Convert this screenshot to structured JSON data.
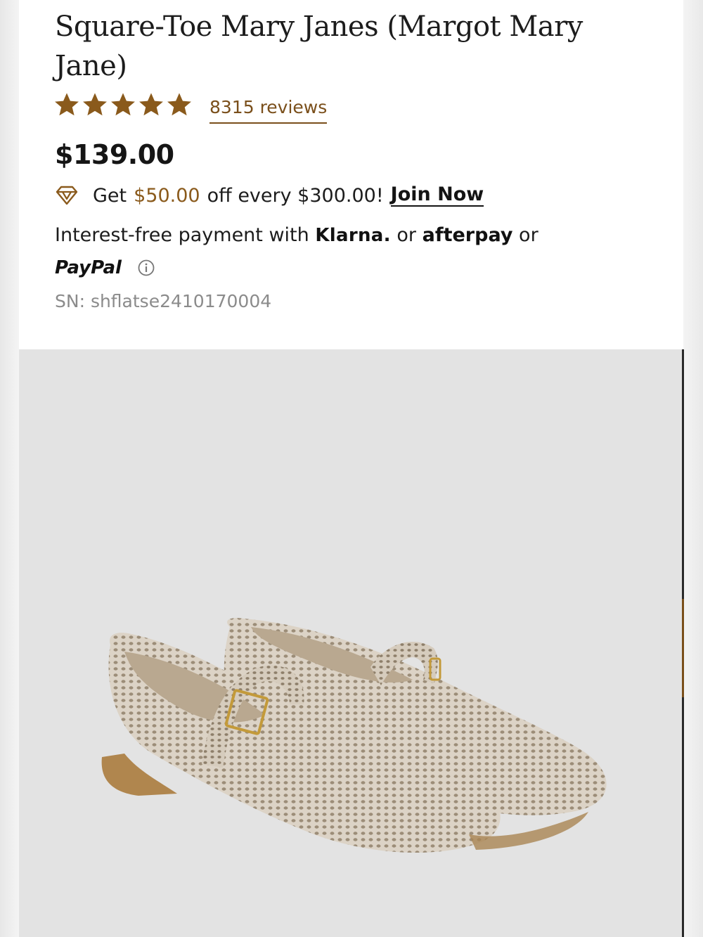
{
  "product": {
    "title": "Square-Toe Mary Janes (Margot Mary Jane)",
    "rating_stars": 5,
    "reviews_label": "8315 reviews",
    "price": "$139.00"
  },
  "promo": {
    "text_before": "Get",
    "amount": "$50.00",
    "text_after": "off every $300.00!",
    "join_label": "Join Now",
    "icon": "diamond-icon"
  },
  "payment": {
    "text": "Interest-free payment with",
    "klarna": "Klarna.",
    "or1": "or",
    "afterpay": "afterpay",
    "or2": "or",
    "paypal": "PayPal",
    "info_icon": "info-icon"
  },
  "sn": "SN: shflatse2410170004",
  "colors": {
    "accent": "#7a4f1b",
    "star": "#8a5a1c",
    "text": "#1c1c1c",
    "muted": "#8b8b8b",
    "image_bg": "#e3e3e3"
  }
}
